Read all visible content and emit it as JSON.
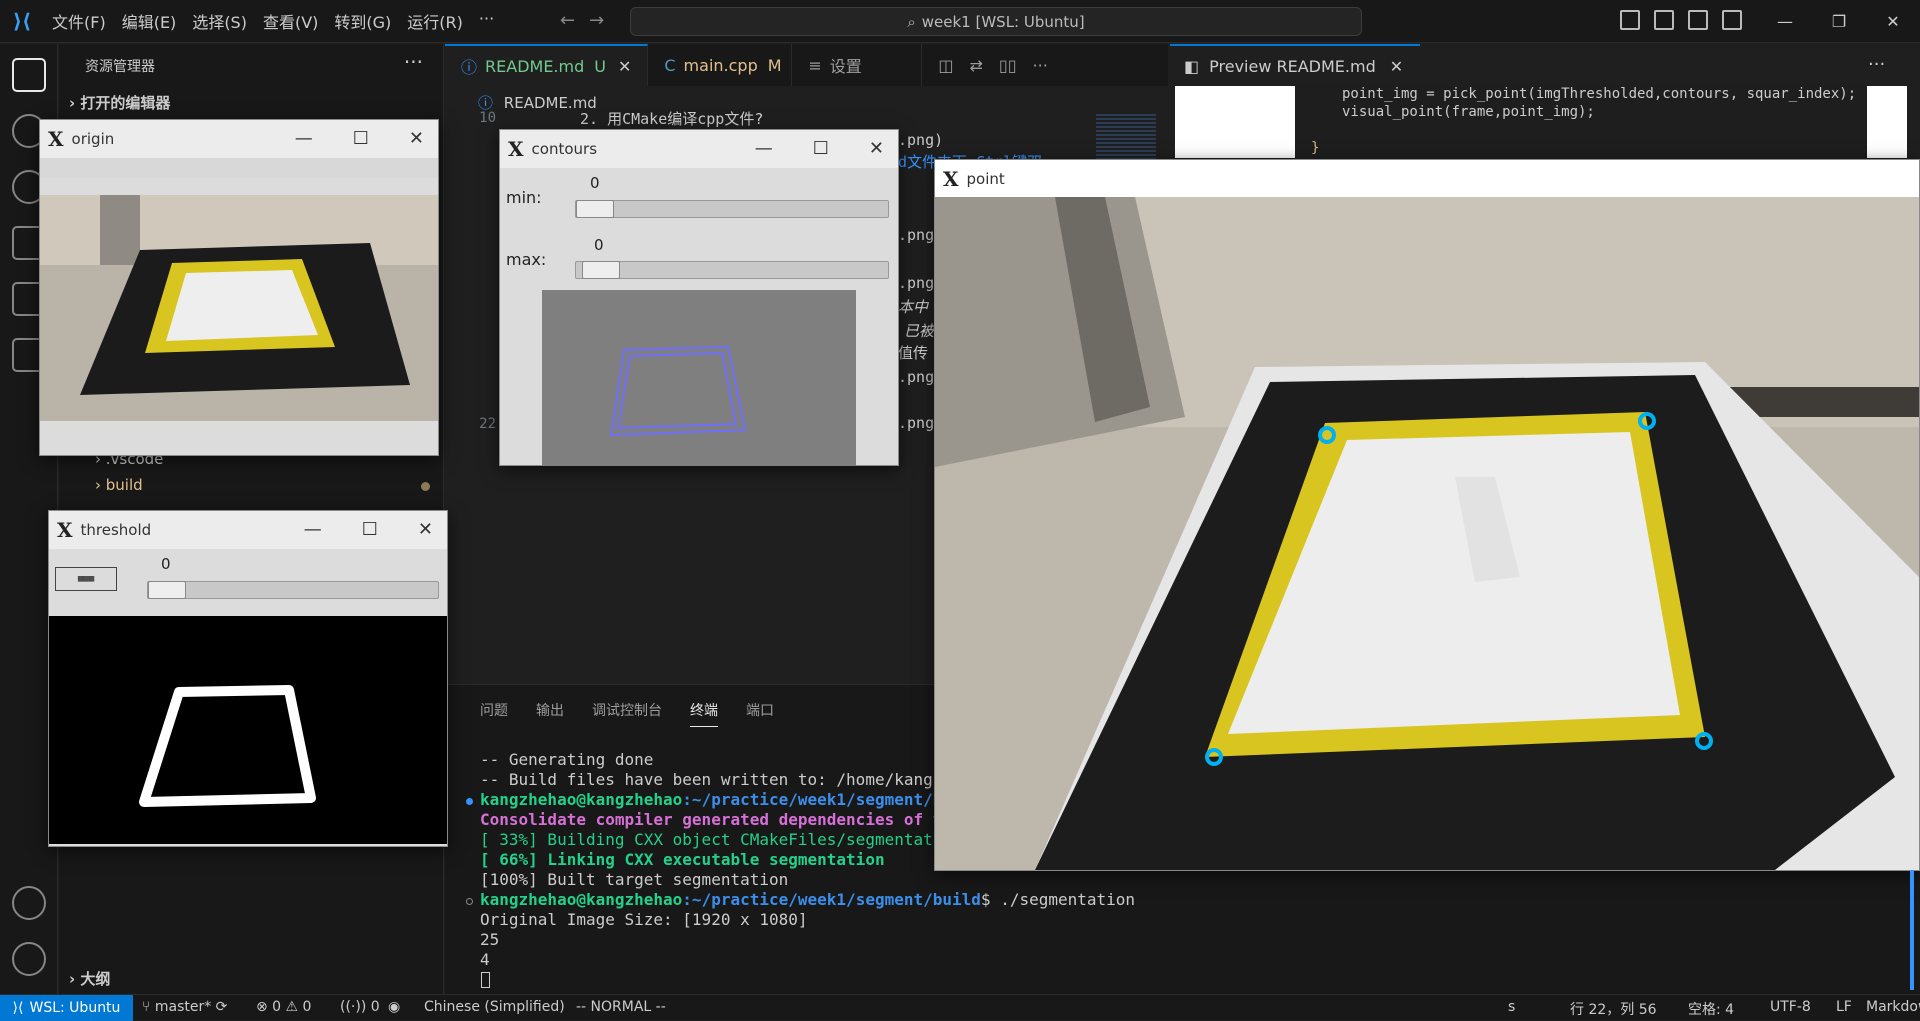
{
  "titlebar": {
    "menu": [
      "文件(F)",
      "编辑(E)",
      "选择(S)",
      "查看(V)",
      "转到(G)",
      "运行(R)",
      "···"
    ],
    "search": "week1 [WSL: Ubuntu]",
    "win_min": "—",
    "win_max": "❐",
    "win_close": "✕"
  },
  "sidebar": {
    "title": "资源管理器",
    "more": "···",
    "open_editors": "打开的编辑器",
    "items": [
      {
        "label": ".vscode"
      },
      {
        "label": "build"
      }
    ],
    "outline": "大纲"
  },
  "editor": {
    "tabs": [
      {
        "label": "README.md",
        "badge": "U",
        "close": "✕"
      },
      {
        "label": "main.cpp",
        "badge": "M"
      },
      {
        "label": "设置"
      }
    ],
    "breadcrumb": "README.md",
    "line_numbers": [
      "10",
      "22"
    ],
    "lines": [
      "2. 用CMake编译cpp文件?",
      ".png)",
      "d文件夹下 Ctrl键双",
      ".png",
      ".png",
      "本中",
      "已被",
      "值传",
      ".png",
      ".png"
    ]
  },
  "preview": {
    "tab_label": "Preview README.md",
    "tab_close": "✕",
    "code": [
      "point_img = pick_point(imgThresholded,contours, squar_index);",
      "visual_point(frame,point_img);",
      "}"
    ]
  },
  "panel": {
    "tabs": [
      "问题",
      "输出",
      "调试控制台",
      "终端",
      "端口"
    ],
    "active_tab": "终端",
    "terminal": [
      {
        "text": "-- Generating done",
        "color": "#cccccc"
      },
      {
        "text": "-- Build files have been written to: /home/kangzheh",
        "color": "#cccccc"
      },
      {
        "prompt_user": "kangzhehao@kangzhehao",
        "prompt_path": ":~/practice/week1/segment/build",
        "cmd": ""
      },
      {
        "text": "Consolidate compiler generated dependencies of targ",
        "color": "#d670d6"
      },
      {
        "text": "[ 33%] Building CXX object CMakeFiles/segmentation.",
        "color": "#23d18b"
      },
      {
        "text": "[ 66%] Linking CXX executable segmentation",
        "color": "#23d18b"
      },
      {
        "text": "[100%] Built target segmentation",
        "color": "#cccccc"
      },
      {
        "prompt_user": "kangzhehao@kangzhehao",
        "prompt_path": ":~/practice/week1/segment/build",
        "cmd": "$ ./segmentation"
      },
      {
        "text": "Original Image Size: [1920 x 1080]",
        "color": "#cccccc"
      },
      {
        "text": "25",
        "color": "#cccccc"
      },
      {
        "text": "4",
        "color": "#cccccc"
      }
    ]
  },
  "statusbar": {
    "remote": "WSL: Ubuntu",
    "branch": "master*",
    "errors": "⊗ 0 ⚠ 0",
    "ports": "0",
    "language_pack": "Chinese (Simplified)",
    "vim_mode": "-- NORMAL --",
    "s": "s",
    "position": "行 22，列 56",
    "spaces": "空格: 4",
    "encoding": "UTF-8",
    "eol": "LF",
    "language": "Markdown"
  },
  "windows": {
    "origin": {
      "title": "origin"
    },
    "threshold": {
      "title": "threshold",
      "slider_value": "0"
    },
    "contours": {
      "title": "contours",
      "min_label": "min:",
      "min_value": "0",
      "max_label": "max:",
      "max_value": "0"
    },
    "point": {
      "title": "point"
    }
  },
  "colors": {
    "accent": "#0078d4",
    "marker": "#00b0f0",
    "tape": "#d8c520"
  }
}
